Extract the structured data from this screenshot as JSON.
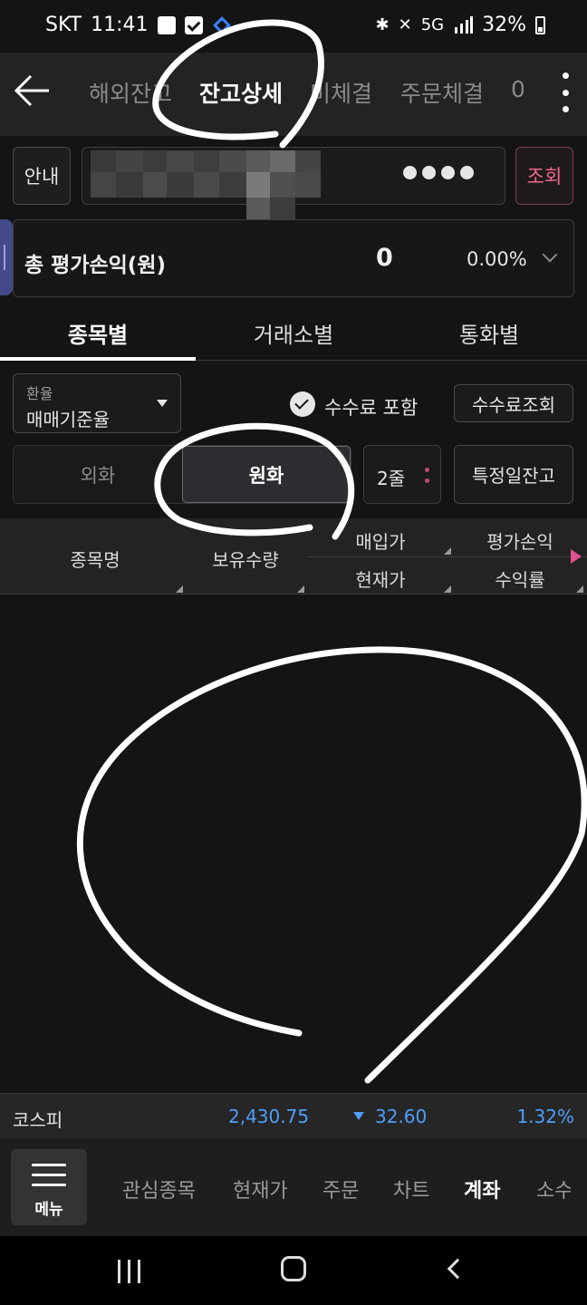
{
  "status_bar": {
    "carrier": "SKT",
    "time": "11:41",
    "network": "5G",
    "battery": "32%"
  },
  "header": {
    "tabs": [
      {
        "label": "해외잔고",
        "active": false
      },
      {
        "label": "잔고상세",
        "active": true
      },
      {
        "label": "미체결",
        "active": false
      },
      {
        "label": "주문체결",
        "active": false
      },
      {
        "label": "0",
        "active": false
      }
    ]
  },
  "account": {
    "info_label": "안내",
    "password_mask": "●●●●",
    "query_label": "조회"
  },
  "total": {
    "label": "총 평가손익(원)",
    "value": "0",
    "rate": "0.00%"
  },
  "sub_tabs": [
    {
      "label": "종목별",
      "active": true
    },
    {
      "label": "거래소별",
      "active": false
    },
    {
      "label": "통화별",
      "active": false
    }
  ],
  "exchange_rate": {
    "caption": "환율",
    "value": "매매기준율"
  },
  "fee": {
    "include_label": "수수료 포함",
    "checked": true,
    "lookup_label": "수수료조회"
  },
  "currency_toggle": {
    "foreign_label": "외화",
    "won_label": "원화",
    "selected": "원화"
  },
  "lines_label": "2줄",
  "date_balance_label": "특정일잔고",
  "table_header": {
    "name": "종목명",
    "quantity": "보유수량",
    "buy_price": "매입가",
    "current_price": "현재가",
    "eval_pl": "평가손익",
    "return_rate": "수익률"
  },
  "index": {
    "name": "코스피",
    "value": "2,430.75",
    "change": "32.60",
    "rate": "1.32%",
    "color": "#4f9ef8"
  },
  "bottom_nav": {
    "menu_label": "메뉴",
    "items": [
      {
        "label": "관심종목",
        "active": false
      },
      {
        "label": "현재가",
        "active": false
      },
      {
        "label": "주문",
        "active": false
      },
      {
        "label": "차트",
        "active": false
      },
      {
        "label": "계좌",
        "active": true
      },
      {
        "label": "소수",
        "active": false
      }
    ]
  },
  "colors": {
    "accent_pink": "#f06a8e",
    "background": "#141414",
    "panel": "#232323"
  }
}
